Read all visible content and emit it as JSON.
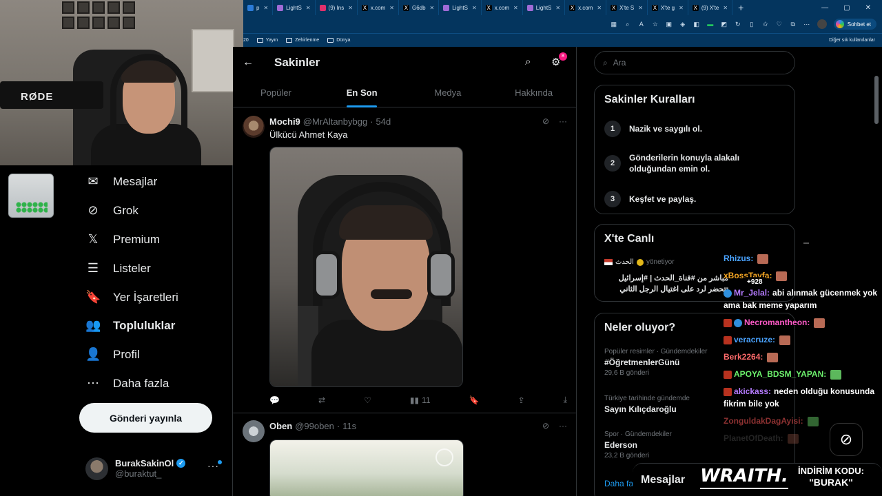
{
  "browser": {
    "tabs": [
      {
        "label": "p",
        "icon": "edge-icon"
      },
      {
        "label": "LightS",
        "icon": "pen-icon"
      },
      {
        "label": "(9) Ins",
        "icon": "instagram-icon"
      },
      {
        "label": "x.com",
        "icon": "x-icon"
      },
      {
        "label": "G6db",
        "icon": "x-icon"
      },
      {
        "label": "LightS",
        "icon": "pen-icon"
      },
      {
        "label": "x.com",
        "icon": "x-icon"
      },
      {
        "label": "LightS",
        "icon": "pen-icon"
      },
      {
        "label": "x.com",
        "icon": "x-icon"
      },
      {
        "label": "X'te S",
        "icon": "x-icon"
      },
      {
        "label": "X'te g",
        "icon": "x-icon"
      },
      {
        "label": "(9) X'te",
        "icon": "x-icon"
      }
    ],
    "copilot_label": "Sohbet et",
    "bookmarks": [
      "20",
      "Yayın",
      "Zehirlenme",
      "Dünya"
    ],
    "other_bookmarks": "Diğer sık kullanılanlar"
  },
  "webcam": {
    "mic_brand": "RØDE"
  },
  "nav": {
    "items": [
      {
        "label": "Mesajlar",
        "icon": "envelope-icon",
        "glyph": "✉",
        "bold": false
      },
      {
        "label": "Grok",
        "icon": "grok-icon",
        "glyph": "⊘",
        "bold": false
      },
      {
        "label": "Premium",
        "icon": "x-logo-icon",
        "glyph": "𝕏",
        "bold": false
      },
      {
        "label": "Listeler",
        "icon": "list-icon",
        "glyph": "☰",
        "bold": false
      },
      {
        "label": "Yer İşaretleri",
        "icon": "bookmark-icon",
        "glyph": "🔖",
        "bold": false
      },
      {
        "label": "Topluluklar",
        "icon": "communities-icon",
        "glyph": "👥",
        "bold": true
      },
      {
        "label": "Profil",
        "icon": "person-icon",
        "glyph": "👤",
        "bold": false
      },
      {
        "label": "Daha fazla",
        "icon": "more-circle-icon",
        "glyph": "⋯",
        "bold": false
      }
    ],
    "post_button": "Gönderi yayınla",
    "account": {
      "name": "BurakSakinOl",
      "handle": "@buraktut_"
    }
  },
  "community": {
    "title": "Sakinler",
    "notification_count": "8",
    "tabs": [
      {
        "label": "Popüler",
        "active": false
      },
      {
        "label": "En Son",
        "active": true
      },
      {
        "label": "Medya",
        "active": false
      },
      {
        "label": "Hakkında",
        "active": false
      }
    ]
  },
  "posts": [
    {
      "name": "Mochi9",
      "handle": "@MrAltanbybgg",
      "time": "54d",
      "text": "Ülkücü Ahmet Kaya",
      "views": "11"
    },
    {
      "name": "Oben",
      "handle": "@99oben",
      "time": "11s",
      "text": ""
    }
  ],
  "sidebar": {
    "search_placeholder": "Ara",
    "rules": {
      "title": "Sakinler Kuralları",
      "items": [
        {
          "num": "1",
          "text": "Nazik ve saygılı ol."
        },
        {
          "num": "2",
          "text": "Gönderilerin konuyla alakalı olduğundan emin ol."
        },
        {
          "num": "3",
          "text": "Keşfet ve paylaş."
        }
      ]
    },
    "live": {
      "title": "X'te Canlı",
      "host": "الحدث",
      "role": "yönetiyor",
      "text": "مباشر من #قناة_الحدث | #إسرائيل تتحضر لرد على اغتيال الرجل الثاني"
    },
    "trends": {
      "title": "Neler oluyor?",
      "items": [
        {
          "context": "Popüler resimler · Gündemdekiler",
          "topic": "#ÖğretmenlerGünü",
          "count": "29,6 B gönderi"
        },
        {
          "context": "Türkiye tarihinde gündemde",
          "topic": "Sayın Kılıçdaroğlu",
          "count": ""
        },
        {
          "context": "Spor · Gündemdekiler",
          "topic": "Ederson",
          "count": "23,2 B gönderi"
        }
      ],
      "show_more": "Daha fa"
    }
  },
  "chat": {
    "viewers": "+928",
    "messages": [
      {
        "user": "Rhizus:",
        "color": "#4aa3ff",
        "text": "",
        "emote": true,
        "badge": ""
      },
      {
        "user": "xBossTayfa:",
        "color": "#f5a623",
        "text": "",
        "emote": true,
        "badge": ""
      },
      {
        "user": "Mr_Jelal:",
        "color": "#b57bff",
        "text": "abi alınmak gücenmek yok ama bak meme yaparım",
        "emote": false,
        "badge": "b"
      },
      {
        "user": "Necromantheon:",
        "color": "#ff5ac8",
        "text": "",
        "emote": true,
        "badge": "rb"
      },
      {
        "user": "veracruze:",
        "color": "#4aa3ff",
        "text": "",
        "emote": true,
        "badge": "r"
      },
      {
        "user": "Berk2264:",
        "color": "#ff6b6b",
        "text": "",
        "emote": true,
        "badge": ""
      },
      {
        "user": "APOYA_BDSM_YAPAN:",
        "color": "#6cf06c",
        "text": "",
        "emote": true,
        "badge": "r"
      },
      {
        "user": "akickass:",
        "color": "#b57bff",
        "text": "neden olduğu konusunda fikrim bile yok",
        "emote": false,
        "badge": "r"
      },
      {
        "user": "ZonguldakDagAyisi:",
        "color": "#ff5a5a",
        "text": "",
        "emote": true,
        "badge": ""
      },
      {
        "user": "PlanetOfDeath:",
        "color": "#777",
        "text": "",
        "emote": true,
        "badge": ""
      }
    ]
  },
  "bottom": {
    "messages_label": "Mesajlar",
    "sponsor": "WRAITH.",
    "promo_line1": "İNDİRİM KODU:",
    "promo_code": "\"BURAK\""
  }
}
